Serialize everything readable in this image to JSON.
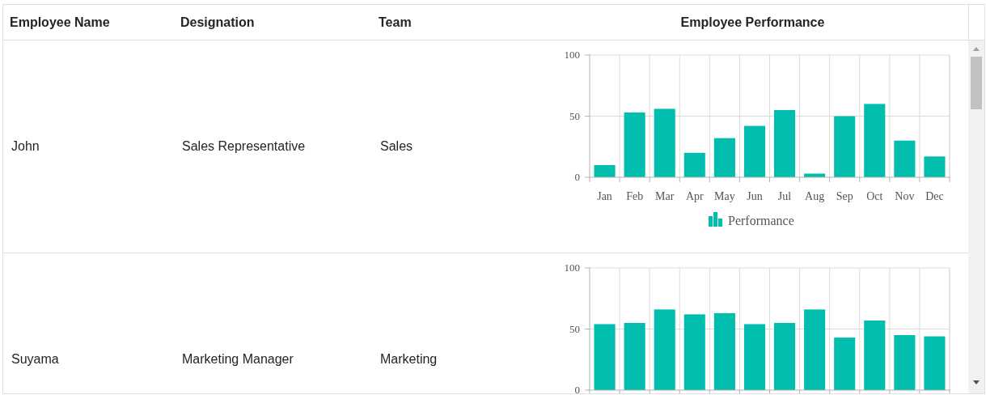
{
  "table": {
    "columns": [
      {
        "label": "Employee Name"
      },
      {
        "label": "Designation"
      },
      {
        "label": "Team"
      },
      {
        "label": "Employee Performance"
      }
    ],
    "rows": [
      {
        "name": "John",
        "designation": "Sales Representative",
        "team": "Sales",
        "performance": {
          "chart_data": {
            "type": "bar",
            "categories": [
              "Jan",
              "Feb",
              "Mar",
              "Apr",
              "May",
              "Jun",
              "Jul",
              "Aug",
              "Sep",
              "Oct",
              "Nov",
              "Dec"
            ],
            "ylim": [
              0,
              100
            ],
            "yticks": [
              0,
              50,
              100
            ],
            "series": [
              {
                "name": "Performance",
                "color": "#00bdae",
                "values": [
                  10,
                  53,
                  56,
                  20,
                  32,
                  42,
                  55,
                  3,
                  50,
                  60,
                  30,
                  17
                ]
              }
            ]
          }
        }
      },
      {
        "name": "Suyama",
        "designation": "Marketing Manager",
        "team": "Marketing",
        "performance": {
          "chart_data": {
            "type": "bar",
            "ylim": [
              0,
              100
            ],
            "yticks": [
              0,
              50,
              100
            ],
            "series": [
              {
                "color": "#00bdae",
                "values": [
                  54,
                  55,
                  66,
                  62,
                  63,
                  54,
                  55,
                  66,
                  43,
                  57,
                  45,
                  44
                ]
              }
            ]
          }
        }
      }
    ]
  }
}
